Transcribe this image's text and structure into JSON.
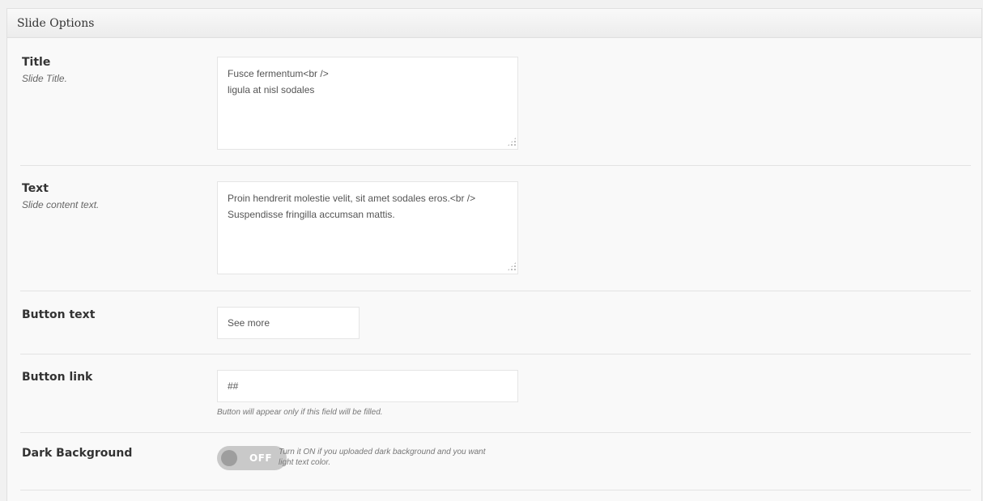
{
  "panel": {
    "title": "Slide Options"
  },
  "fields": {
    "title": {
      "label": "Title",
      "description": "Slide Title.",
      "value": "Fusce fermentum<br />\nligula at nisl sodales"
    },
    "text": {
      "label": "Text",
      "description": "Slide content text.",
      "value": "Proin hendrerit molestie velit, sit amet sodales eros.<br />\nSuspendisse fringilla accumsan mattis."
    },
    "button_text": {
      "label": "Button text",
      "value": "See more"
    },
    "button_link": {
      "label": "Button link",
      "value": "##",
      "help": "Button will appear only if this field will be filled."
    },
    "dark_background": {
      "label": "Dark Background",
      "state": "OFF",
      "help": "Turn it ON if you uploaded dark background and you want light text color."
    }
  },
  "icons": {
    "resize_grip": "resize-grip-icon"
  }
}
